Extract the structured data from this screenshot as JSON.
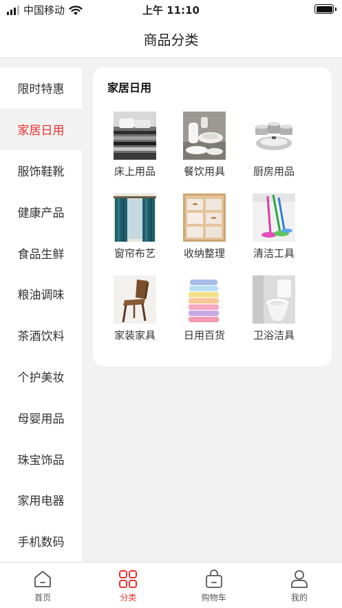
{
  "status_bar": {
    "carrier": "中国移动",
    "time": "上午 11:10"
  },
  "header": {
    "title": "商品分类"
  },
  "sidebar": {
    "items": [
      {
        "label": "限时特惠",
        "active": false
      },
      {
        "label": "家居日用",
        "active": true
      },
      {
        "label": "服饰鞋靴",
        "active": false
      },
      {
        "label": "健康产品",
        "active": false
      },
      {
        "label": "食品生鲜",
        "active": false
      },
      {
        "label": "粮油调味",
        "active": false
      },
      {
        "label": "茶酒饮料",
        "active": false
      },
      {
        "label": "个护美妆",
        "active": false
      },
      {
        "label": "母婴用品",
        "active": false
      },
      {
        "label": "珠宝饰品",
        "active": false
      },
      {
        "label": "家用电器",
        "active": false
      },
      {
        "label": "手机数码",
        "active": false
      }
    ]
  },
  "category": {
    "title": "家居日用",
    "items": [
      {
        "label": "床上用品",
        "icon": "bedding-image"
      },
      {
        "label": "餐饮用具",
        "icon": "tableware-image"
      },
      {
        "label": "厨房用品",
        "icon": "cookware-image"
      },
      {
        "label": "窗帘布艺",
        "icon": "curtain-image"
      },
      {
        "label": "收纳整理",
        "icon": "storage-image"
      },
      {
        "label": "清洁工具",
        "icon": "mop-image"
      },
      {
        "label": "家装家具",
        "icon": "chair-image"
      },
      {
        "label": "日用百货",
        "icon": "towels-image"
      },
      {
        "label": "卫浴洁具",
        "icon": "toilet-image"
      }
    ]
  },
  "tab_bar": {
    "tabs": [
      {
        "label": "首页",
        "icon": "home-icon"
      },
      {
        "label": "分类",
        "icon": "category-icon"
      },
      {
        "label": "购物车",
        "icon": "cart-icon"
      },
      {
        "label": "我的",
        "icon": "profile-icon"
      }
    ]
  },
  "colors": {
    "accent": "#e8302c",
    "page_bg": "#f2f2f2",
    "card_bg": "#ffffff"
  }
}
